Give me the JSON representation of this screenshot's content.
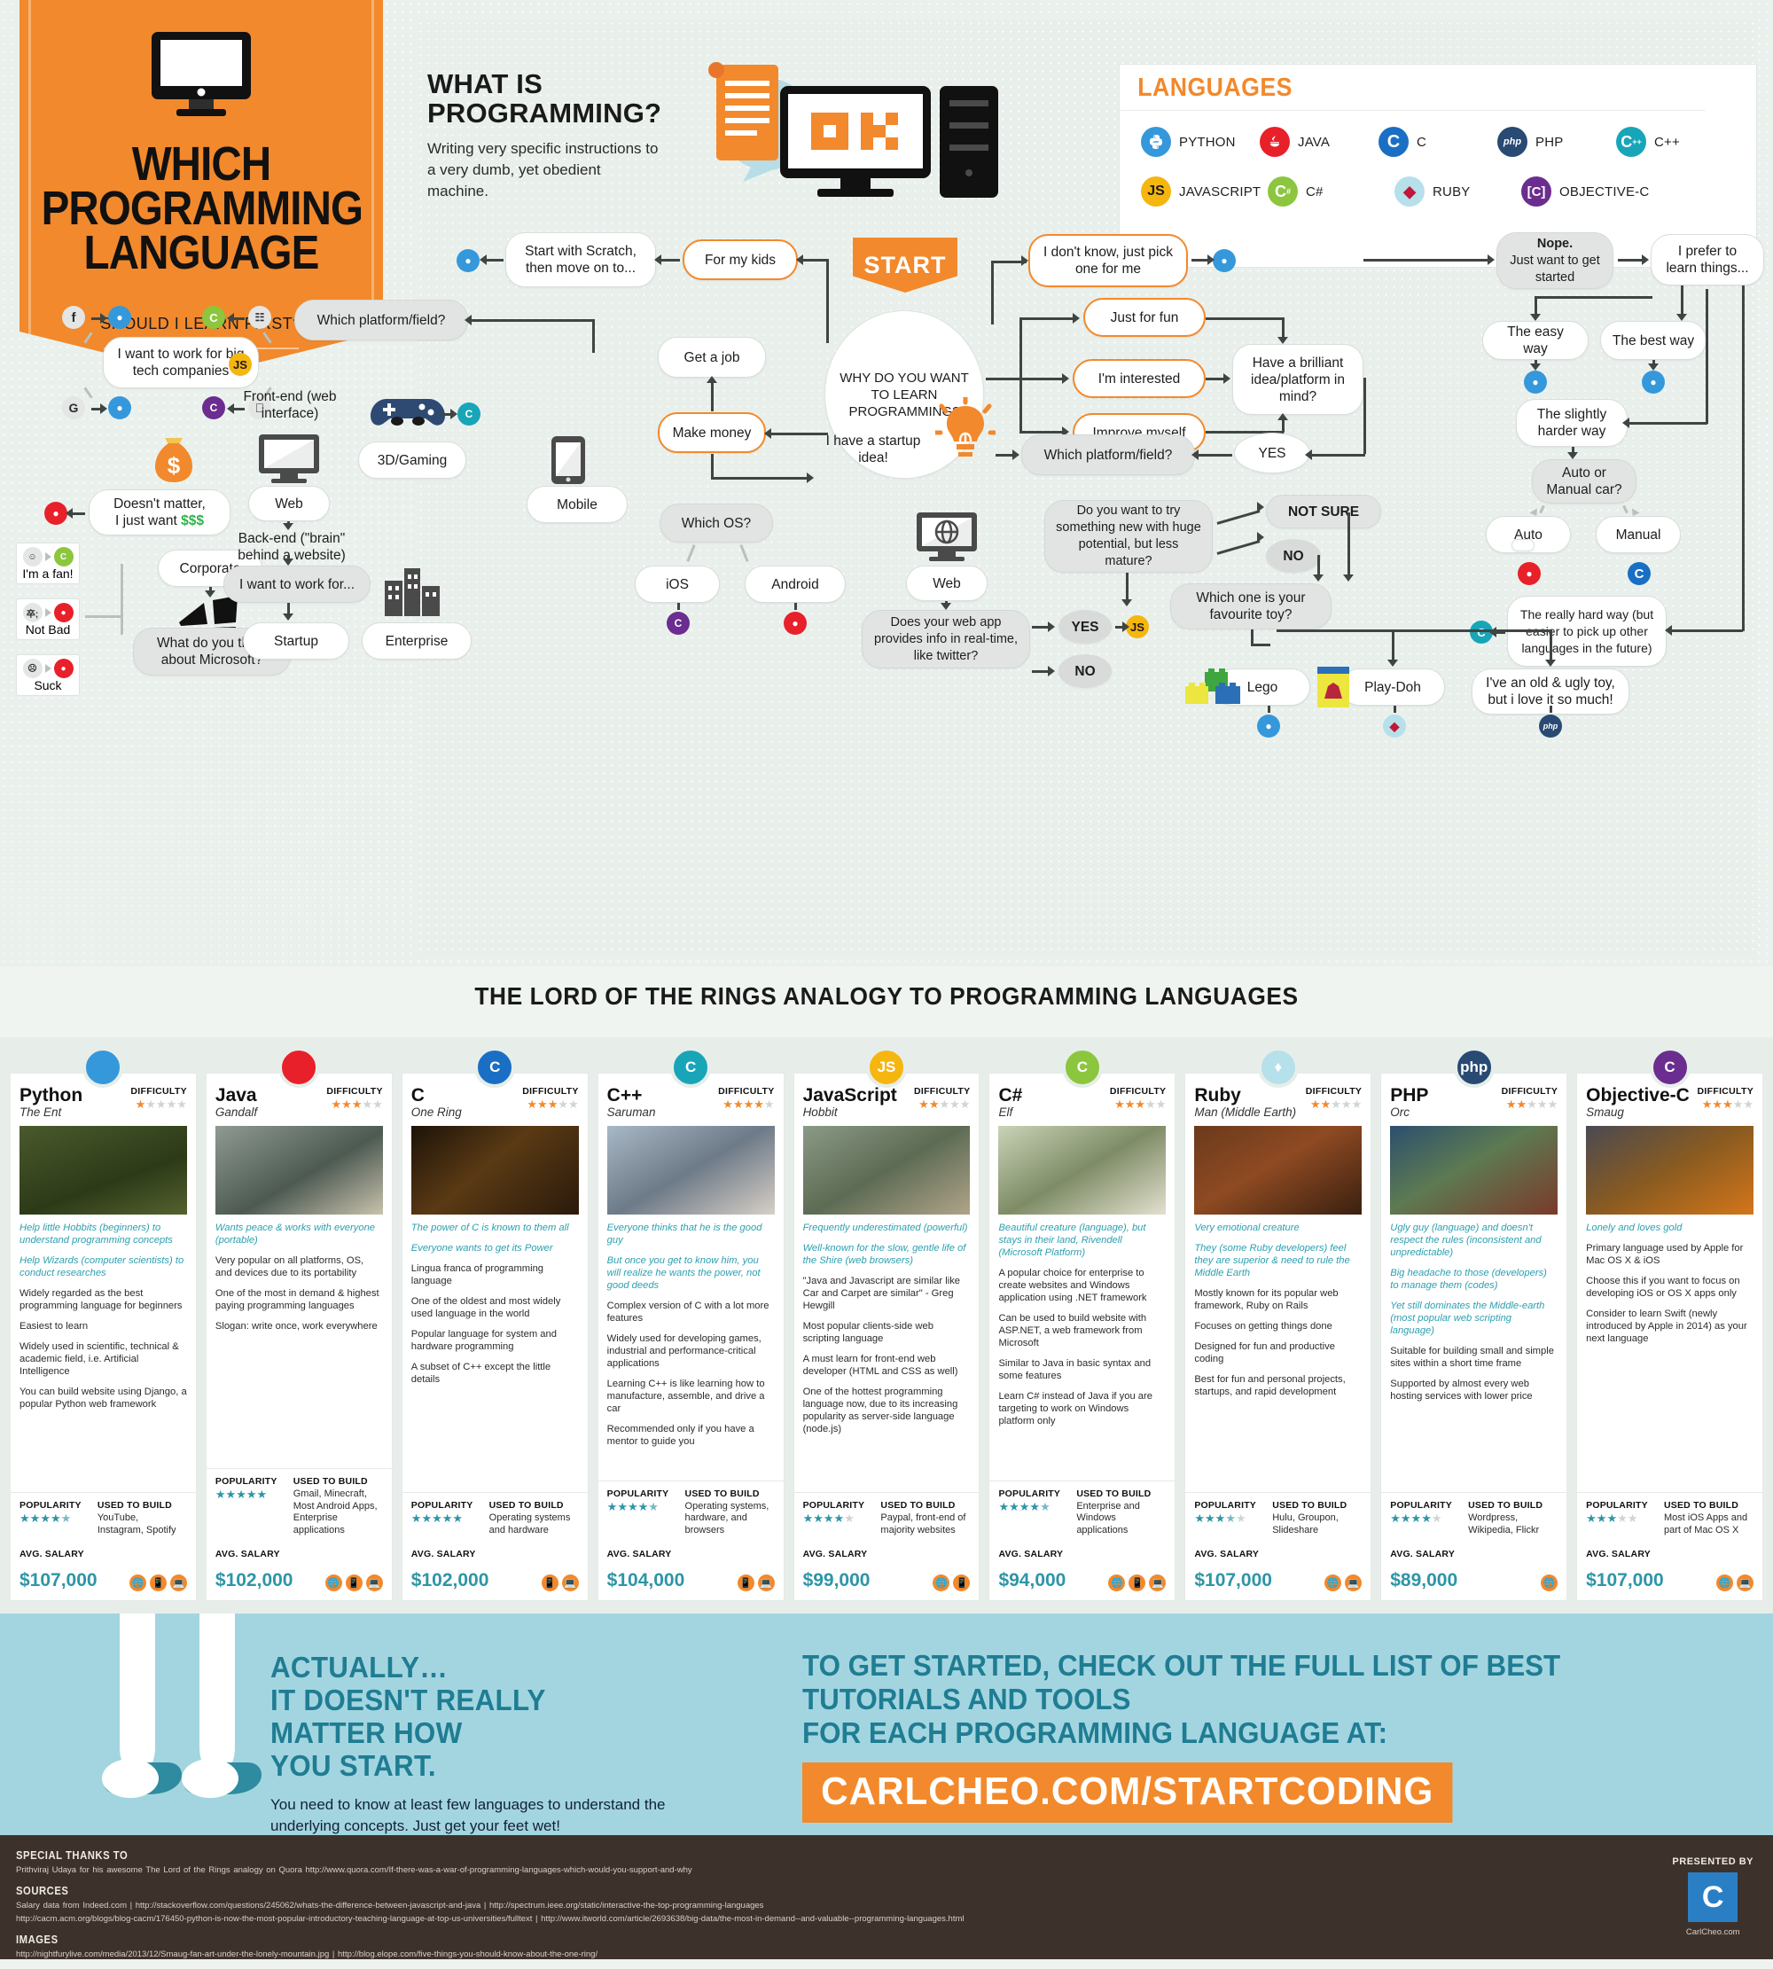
{
  "banner": {
    "title_lines": [
      "WHICH",
      "PROGRAMMING",
      "LANGUAGE"
    ],
    "subtitle": "SHOULD I LEARN FIRST?"
  },
  "what_is": {
    "heading_line1": "WHAT IS",
    "heading_line2": "PROGRAMMING?",
    "body": "Writing very specific instructions to a very dumb, yet obedient machine.",
    "screen_text": "OK"
  },
  "languages_box": {
    "title": "LANGUAGES",
    "row1": [
      {
        "label": "PYTHON",
        "icon": "python-icon",
        "glyph": " ",
        "color": "#3598db"
      },
      {
        "label": "JAVA",
        "icon": "java-icon",
        "glyph": " ",
        "color": "#e8202a"
      },
      {
        "label": "C",
        "icon": "c-icon",
        "glyph": "C",
        "color": "#1a6fc4"
      },
      {
        "label": "PHP",
        "icon": "php-icon",
        "glyph": "php",
        "color": "#294a72"
      },
      {
        "label": "C++",
        "icon": "cplusplus-icon",
        "glyph": "C",
        "color": "#18a5b8"
      }
    ],
    "row2": [
      {
        "label": "JAVASCRIPT",
        "icon": "javascript-icon",
        "glyph": "JS",
        "color": "#f6b610"
      },
      {
        "label": "C#",
        "icon": "csharp-icon",
        "glyph": "C",
        "color": "#8cc63e"
      },
      {
        "label": "RUBY",
        "icon": "ruby-icon",
        "glyph": "♦",
        "color": "#b6e0ea"
      },
      {
        "label": "OBJECTIVE-C",
        "icon": "objectivec-icon",
        "glyph": "C",
        "color": "#6b2d8f"
      }
    ]
  },
  "flow": {
    "start": "START",
    "root": "WHY DO YOU WANT TO LEARN PROGRAMMING?",
    "n_kids": "For my kids",
    "n_scratch": "Start with Scratch, then move on to...",
    "n_dontknow": "I don't know, just pick one for me",
    "n_justforfun": "Just for fun",
    "n_interested": "I'm interested",
    "n_improve": "Improve myself",
    "n_brilliant": "Have a brilliant idea/platform in mind?",
    "n_getajob": "Get a job",
    "n_makemoney": "Make money",
    "n_startupidea": "I have a startup idea!",
    "n_platform1": "Which platform/field?",
    "n_platform2": "Which platform/field?",
    "n_yes_big": "YES",
    "n_nope": "Nope. Just want to get started",
    "n_nope_bold": "Nope.",
    "n_nope_rest": "Just want to get started",
    "n_prefer": "I prefer to learn things...",
    "n_easyway": "The easy way",
    "n_bestway": "The best way",
    "n_slightly": "The slightly harder way",
    "n_automan": "Auto or Manual car?",
    "n_auto": "Auto",
    "n_manual": "Manual",
    "n_reallyhard": "The really hard way (but easier to pick up other languages in the future)",
    "n_bigtech": "I want to work for big tech companies",
    "n_doesntmatter_a": "Doesn't matter,",
    "n_doesntmatter_b": "I just want ",
    "n_doesntmatter_money": "$$$",
    "n_corporate": "Corporate",
    "n_microsoft": "What do you think about Microsoft?",
    "n_fan": "I'm a fan!",
    "n_notbad": "Not Bad",
    "n_suck": "Suck",
    "n_frontend": "Front-end (web interface)",
    "n_backend": "Back-end (\"brain\" behind a website)",
    "n_web_label": "Web",
    "n_workfor": "I want to work for...",
    "n_startup": "Startup",
    "n_enterprise": "Enterprise",
    "n_3dgaming": "3D/Gaming",
    "n_mobile": "Mobile",
    "n_whichos": "Which OS?",
    "n_ios": "iOS",
    "n_android": "Android",
    "n_web2": "Web",
    "n_realtime": "Does your web app provides info in real-time, like twitter?",
    "n_yes_small": "YES",
    "n_no_small": "NO",
    "n_trynew": "Do you want to try something new with huge potential, but less mature?",
    "n_notsure": "NOT SURE",
    "n_no2": "NO",
    "n_favtoy": "Which one is your favourite toy?",
    "n_lego": "Lego",
    "n_playdoh": "Play-Doh",
    "n_oldugly": "I've an old & ugly toy, but i love it so much!"
  },
  "lotr": {
    "title": "THE LORD OF THE RINGS ANALOGY TO PROGRAMMING LANGUAGES"
  },
  "card_labels": {
    "difficulty": "DIFFICULTY",
    "popularity": "POPULARITY",
    "used_to_build": "USED TO BUILD",
    "avg_salary": "AVG. SALARY"
  },
  "chart_data": {
    "type": "table",
    "title": "THE LORD OF THE RINGS ANALOGY TO PROGRAMMING LANGUAGES",
    "columns": [
      "name",
      "character",
      "difficulty",
      "popularity",
      "used_to_build",
      "avg_salary",
      "platforms"
    ],
    "rows": [
      {
        "name": "Python",
        "difficulty": 1,
        "popularity": 4.5,
        "avg_salary_num": 107000
      },
      {
        "name": "Java",
        "difficulty": 3,
        "popularity": 5,
        "avg_salary_num": 102000
      },
      {
        "name": "C",
        "difficulty": 3,
        "popularity": 5,
        "avg_salary_num": 102000
      },
      {
        "name": "C++",
        "difficulty": 4,
        "popularity": 4.5,
        "avg_salary_num": 104000
      },
      {
        "name": "JavaScript",
        "difficulty": 2,
        "popularity": 4,
        "avg_salary_num": 99000
      },
      {
        "name": "C#",
        "difficulty": 3,
        "popularity": 4.5,
        "avg_salary_num": 94000
      },
      {
        "name": "Ruby",
        "difficulty": 2,
        "popularity": 3.5,
        "avg_salary_num": 107000
      },
      {
        "name": "PHP",
        "difficulty": 2,
        "popularity": 4,
        "avg_salary_num": 89000
      },
      {
        "name": "Objective-C",
        "difficulty": 3,
        "popularity": 3,
        "avg_salary_num": 107000
      }
    ]
  },
  "cards": [
    {
      "name": "Python",
      "character": "The Ent",
      "badge_color": "#3598db",
      "badge_glyph": " ",
      "icon": "python-icon",
      "thumb": "linear-gradient(160deg,#4a5a2c,#2c3a18 60%,#55622f)",
      "difficulty": 1,
      "popularity": 4.5,
      "italics": [
        "Help little Hobbits (beginners) to understand programming concepts",
        "Help Wizards (computer scientists) to conduct researches"
      ],
      "plains": [
        "Widely regarded as the best programming language for beginners",
        "Easiest to learn",
        "Widely used in scientific, technical & academic field, i.e. Artificial Intelligence",
        "You can build website using Django, a popular Python web framework"
      ],
      "used_to_build": "YouTube, Instagram, Spotify",
      "salary": "$107,000",
      "platforms": [
        "web",
        "mobile",
        "desktop"
      ]
    },
    {
      "name": "Java",
      "character": "Gandalf",
      "badge_color": "#e8202a",
      "badge_glyph": " ",
      "icon": "java-icon",
      "thumb": "linear-gradient(150deg,#8e9a92,#4d5a52 55%,#c9c2ad)",
      "difficulty": 3,
      "popularity": 5,
      "italics": [
        "Wants peace & works with everyone (portable)"
      ],
      "plains": [
        "Very popular on all platforms, OS, and devices due to its portability",
        "One of the most in demand & highest paying programming languages",
        "Slogan: write once, work everywhere"
      ],
      "used_to_build": "Gmail, Minecraft, Most Android Apps, Enterprise applications",
      "salary": "$102,000",
      "platforms": [
        "web",
        "mobile",
        "desktop"
      ]
    },
    {
      "name": "C",
      "character": "One Ring",
      "badge_color": "#1a6fc4",
      "badge_glyph": "C",
      "icon": "c-icon",
      "thumb": "linear-gradient(140deg,#1d1309,#5a3a14 45%,#2a1a0b)",
      "difficulty": 3,
      "popularity": 5,
      "italics": [
        "The power of C is known to them all",
        "Everyone wants to get its Power"
      ],
      "plains": [
        "Lingua franca of programming language",
        "One of the oldest and most widely used language in the world",
        "Popular language for system and hardware programming",
        "A subset of C++ except the little details"
      ],
      "used_to_build": "Operating systems and hardware",
      "salary": "$102,000",
      "platforms": [
        "mobile",
        "desktop"
      ]
    },
    {
      "name": "C++",
      "character": "Saruman",
      "badge_color": "#18a5b8",
      "badge_glyph": "C",
      "icon": "cplusplus-icon",
      "thumb": "linear-gradient(150deg,#a9b8c6,#6d7a88 50%,#d7cfc6)",
      "difficulty": 4,
      "popularity": 4.5,
      "italics": [
        "Everyone thinks that he is the good guy",
        "But once you get to know him, you will realize he wants the power, not good deeds"
      ],
      "plains": [
        "Complex version of C with a lot more features",
        "Widely used for developing games, industrial and performance-critical applications",
        "Learning C++ is like learning how to manufacture, assemble, and drive a car",
        "Recommended only if you have a mentor to guide you"
      ],
      "used_to_build": "Operating systems, hardware, and browsers",
      "salary": "$104,000",
      "platforms": [
        "mobile",
        "desktop"
      ]
    },
    {
      "name": "JavaScript",
      "character": "Hobbit",
      "badge_color": "#f6b610",
      "badge_glyph": "JS",
      "icon": "javascript-icon",
      "thumb": "linear-gradient(150deg,#8b9a86,#5d6b54 50%,#b0a489)",
      "difficulty": 2,
      "popularity": 4,
      "italics": [
        "Frequently underestimated (powerful)",
        "Well-known for the slow, gentle life of the Shire (web browsers)"
      ],
      "plains": [
        "\"Java and Javascript are similar like Car and Carpet are similar\" - Greg Hewgill",
        "Most popular clients-side web scripting language",
        "A must learn for front-end web developer (HTML and CSS as well)",
        "One of the hottest programming language now, due to its increasing popularity as server-side language (node.js)"
      ],
      "used_to_build": "Paypal, front-end of majority websites",
      "salary": "$99,000",
      "platforms": [
        "web",
        "mobile"
      ]
    },
    {
      "name": "C#",
      "character": "Elf",
      "badge_color": "#8cc63e",
      "badge_glyph": "C",
      "icon": "csharp-icon",
      "thumb": "linear-gradient(150deg,#c9d3b7,#7e8c66 50%,#e3e0cf)",
      "difficulty": 3,
      "popularity": 4.5,
      "italics": [
        "Beautiful creature (language), but stays in their land, Rivendell (Microsoft Platform)"
      ],
      "plains": [
        "A popular choice for enterprise to create websites and Windows application using .NET framework",
        "Can be used to build website with ASP.NET, a web framework from Microsoft",
        "Similar to Java in basic syntax and some features",
        "Learn C# instead of Java if you are targeting to work on Windows platform only"
      ],
      "used_to_build": "Enterprise and Windows applications",
      "salary": "$94,000",
      "platforms": [
        "web",
        "mobile",
        "desktop"
      ]
    },
    {
      "name": "Ruby",
      "character": "Man (Middle Earth)",
      "badge_color": "#b6e0ea",
      "badge_glyph": "♦",
      "icon": "ruby-icon",
      "thumb": "linear-gradient(150deg,#6b3a1c,#8e4a22 45%,#3a2010)",
      "difficulty": 2,
      "popularity": 3.5,
      "italics": [
        "Very emotional creature",
        "They (some Ruby developers) feel they are superior & need to rule the Middle Earth"
      ],
      "plains": [
        "Mostly known for its popular web framework, Ruby on Rails",
        "Focuses on getting things done",
        "Designed for fun and productive coding",
        "Best for fun and personal projects, startups, and rapid development"
      ],
      "used_to_build": "Hulu, Groupon, Slideshare",
      "salary": "$107,000",
      "platforms": [
        "web",
        "desktop"
      ]
    },
    {
      "name": "PHP",
      "character": "Orc",
      "badge_color": "#294a72",
      "badge_glyph": "php",
      "icon": "php-icon",
      "thumb": "linear-gradient(150deg,#2c4f6e,#5d7a52 45%,#7a3a2a)",
      "difficulty": 2,
      "popularity": 4,
      "italics": [
        "Ugly guy (language) and doesn't respect the rules (inconsistent and unpredictable)",
        "Big headache to those (developers) to manage them (codes)",
        "Yet still dominates the Middle-earth (most popular web scripting language)"
      ],
      "plains": [
        "Suitable for building small and simple sites within a short time frame",
        "Supported by almost every web hosting services with lower price"
      ],
      "used_to_build": "Wordpress, Wikipedia, Flickr",
      "salary": "$89,000",
      "platforms": [
        "web"
      ]
    },
    {
      "name": "Objective-C",
      "character": "Smaug",
      "badge_color": "#6b2d8f",
      "badge_glyph": "C",
      "icon": "objectivec-icon",
      "thumb": "linear-gradient(150deg,#4a4a52,#8a5b20 50%,#d4761a)",
      "difficulty": 3,
      "popularity": 3,
      "italics": [
        "Lonely and loves gold"
      ],
      "plains": [
        "Primary language used by Apple for Mac OS X & iOS",
        "Choose this if you want to focus on developing iOS or OS X apps only",
        "Consider to learn Swift (newly introduced by Apple in 2014) as your next language"
      ],
      "used_to_build": "Most iOS Apps and part of Mac OS X",
      "salary": "$107,000",
      "platforms": [
        "web",
        "desktop"
      ]
    }
  ],
  "cta": {
    "left_h1": "ACTUALLY…",
    "left_h2": "IT DOESN'T REALLY MATTER HOW",
    "left_h3": "YOU START.",
    "left_p": "You need to know at least few languages to understand the underlying concepts. Just get your feet wet!",
    "right_h1": "TO GET STARTED, CHECK OUT THE FULL LIST OF BEST TUTORIALS AND TOOLS",
    "right_h2": "FOR EACH PROGRAMMING LANGUAGE AT:",
    "url": "CARLCHEO.COM/STARTCODING"
  },
  "footer": {
    "thanks_h": "SPECIAL THANKS TO",
    "thanks_p": "Prithviraj Udaya for his awesome The Lord of the Rings analogy on Quora  http://www.quora.com/If-there-was-a-war-of-programming-languages-which-would-you-support-and-why",
    "sources_h": "SOURCES",
    "sources_p1": "Salary data from Indeed.com  |  http://stackoverflow.com/questions/245062/whats-the-difference-between-javascript-and-java  |  http://spectrum.ieee.org/static/interactive-the-top-programming-languages",
    "sources_p2": "http://cacm.acm.org/blogs/blog-cacm/176450-python-is-now-the-most-popular-introductory-teaching-language-at-top-us-universities/fulltext  |  http://www.itworld.com/article/2693638/big-data/the-most-in-demand--and-valuable--programming-languages.html",
    "images_h": "IMAGES",
    "images_p": "http://nightfurylive.com/media/2013/12/Smaug-fan-art-under-the-lonely-mountain.jpg  |  http://blog.elope.com/five-things-you-should-know-about-the-one-ring/",
    "presented_by": "PRESENTED BY",
    "logo_letter": "C",
    "site": "CarlCheo.com"
  }
}
